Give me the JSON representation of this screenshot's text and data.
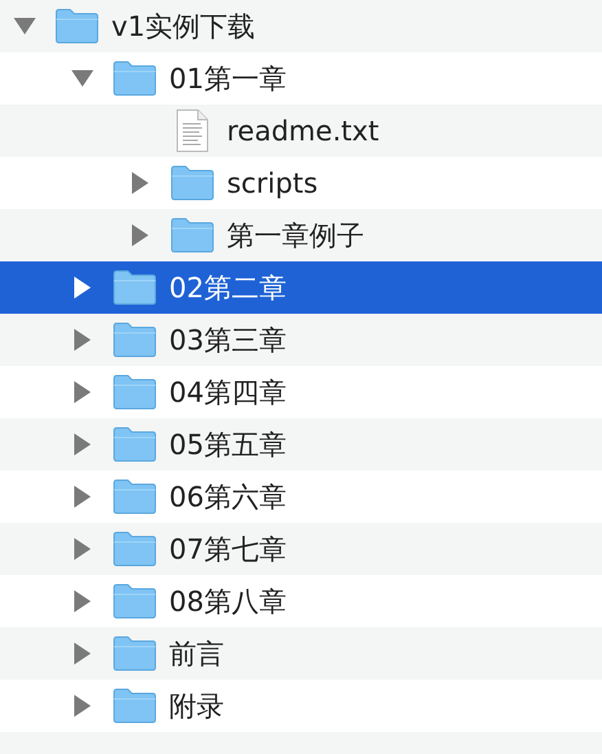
{
  "tree": [
    {
      "name": "v1实例下载",
      "kind": "folder",
      "expanded": true,
      "selected": false,
      "children": [
        {
          "name": "01第一章",
          "kind": "folder",
          "expanded": true,
          "selected": false,
          "children": [
            {
              "name": "readme.txt",
              "kind": "file",
              "selected": false
            },
            {
              "name": "scripts",
              "kind": "folder",
              "expanded": false,
              "selected": false
            },
            {
              "name": "第一章例子",
              "kind": "folder",
              "expanded": false,
              "selected": false
            }
          ]
        },
        {
          "name": "02第二章",
          "kind": "folder",
          "expanded": false,
          "selected": true
        },
        {
          "name": "03第三章",
          "kind": "folder",
          "expanded": false,
          "selected": false
        },
        {
          "name": "04第四章",
          "kind": "folder",
          "expanded": false,
          "selected": false
        },
        {
          "name": "05第五章",
          "kind": "folder",
          "expanded": false,
          "selected": false
        },
        {
          "name": "06第六章",
          "kind": "folder",
          "expanded": false,
          "selected": false
        },
        {
          "name": "07第七章",
          "kind": "folder",
          "expanded": false,
          "selected": false
        },
        {
          "name": "08第八章",
          "kind": "folder",
          "expanded": false,
          "selected": false
        },
        {
          "name": "前言",
          "kind": "folder",
          "expanded": false,
          "selected": false
        },
        {
          "name": "附录",
          "kind": "folder",
          "expanded": false,
          "selected": false
        }
      ]
    }
  ]
}
